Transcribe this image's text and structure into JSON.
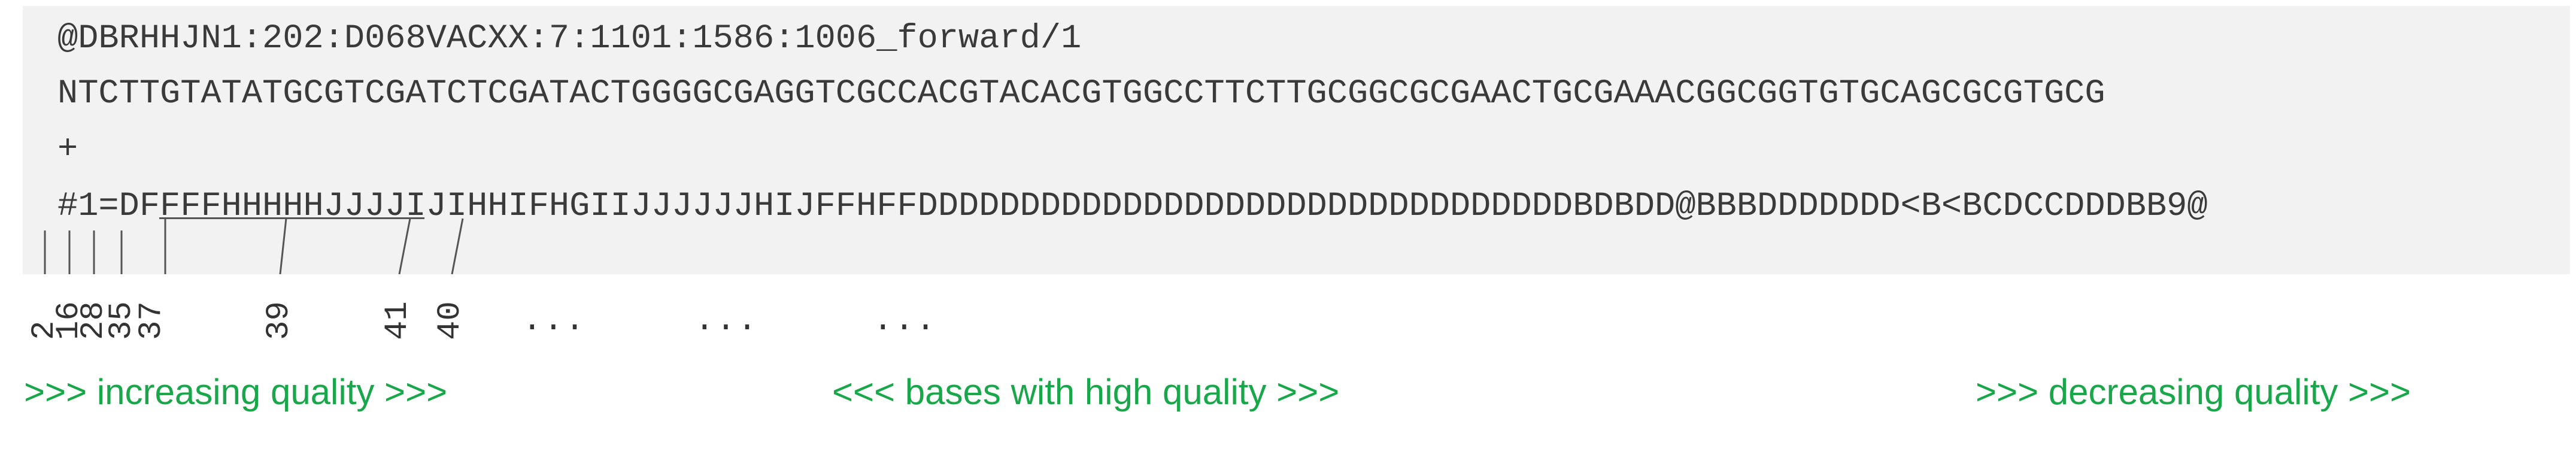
{
  "record": {
    "header": "@DBRHHJN1:202:D068VACXX:7:1101:1586:1006_forward/1",
    "sequence": "NTCTTGTATATGCGTCGATCTCGATACTGGGGCGAGGTCGCCACGTACACGTGGCCTTCTTGCGGCGCGAACTGCGAAACGGCGGTGTGCAGCGCGTGCG",
    "separator": "+",
    "quality": "#1=DFFFFHHHHHJJJJIJIHHIFHGIIJJJJJJHIJFFHFFDDDDDDDDDDDDDDDDDDDDDDDDDDDDDDDDBDBDD@BBBDDDDDDD<B<BCDCCDDDBB9@"
  },
  "score_labels": [
    "2",
    "16",
    "28",
    "35",
    "37",
    "39",
    "41",
    "40"
  ],
  "ellipses": [
    "...",
    "...",
    "..."
  ],
  "captions": {
    "increasing": ">>> increasing quality >>>",
    "high": "<<< bases with high quality >>>",
    "decreasing": ">>> decreasing quality >>>"
  },
  "colors": {
    "caption": "#1aa64a",
    "background": "#f2f2f2",
    "text": "#3a3a3a"
  }
}
